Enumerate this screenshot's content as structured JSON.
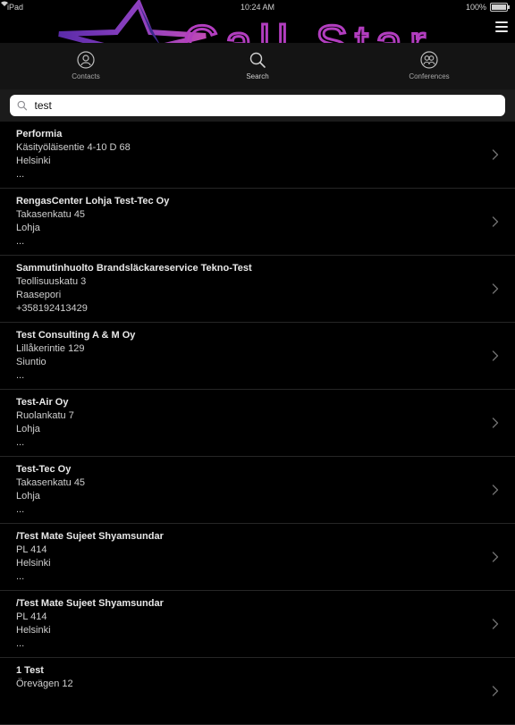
{
  "status": {
    "left": "iPad",
    "time": "10:24 AM",
    "battery": "100%",
    "battery_level": 1.0
  },
  "brand": {
    "logo_text": "Call Star"
  },
  "tabs": [
    {
      "label": "Contacts",
      "icon": "contacts-icon"
    },
    {
      "label": "Search",
      "icon": "search-icon"
    },
    {
      "label": "Conferences",
      "icon": "conferences-icon"
    }
  ],
  "search": {
    "value": "test",
    "placeholder": ""
  },
  "results": [
    {
      "name": "Performia",
      "street": "Käsityöläisentie 4-10 D 68",
      "city": "Helsinki",
      "extra": "..."
    },
    {
      "name": "RengasCenter Lohja Test-Tec Oy",
      "street": "Takasenkatu 45",
      "city": "Lohja",
      "extra": "..."
    },
    {
      "name": "Sammutinhuolto Brandsläckareservice Tekno-Test",
      "street": "Teollisuuskatu 3",
      "city": "Raasepori",
      "extra": "+358192413429"
    },
    {
      "name": "Test Consulting A & M Oy",
      "street": "Lillåkerintie 129",
      "city": "Siuntio",
      "extra": "..."
    },
    {
      "name": "Test-Air Oy",
      "street": "Ruolankatu 7",
      "city": "Lohja",
      "extra": "..."
    },
    {
      "name": "Test-Tec Oy",
      "street": "Takasenkatu 45",
      "city": "Lohja",
      "extra": "..."
    },
    {
      "name": "/Test Mate Sujeet Shyamsundar",
      "street": "PL 414",
      "city": "Helsinki",
      "extra": "..."
    },
    {
      "name": "/Test Mate Sujeet Shyamsundar",
      "street": "PL 414",
      "city": "Helsinki",
      "extra": "..."
    },
    {
      "name": "1 Test",
      "street": "Örevägen 12",
      "city": "",
      "extra": ""
    }
  ]
}
